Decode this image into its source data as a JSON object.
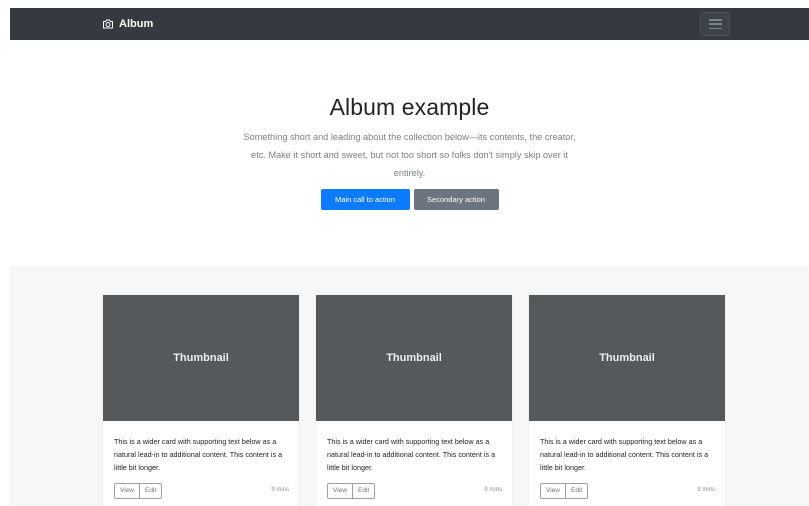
{
  "navbar": {
    "brand": "Album",
    "brand_icon": "camera-icon",
    "toggler_icon": "hamburger-menu-icon",
    "background": "#343a40"
  },
  "hero": {
    "title": "Album example",
    "lead": "Something short and leading about the collection below—its contents, the creator, etc. Make it short and sweet, but not too short so folks don't simply skip over it entirely.",
    "primary_button": "Main call to action",
    "secondary_button": "Secondary action",
    "primary_color": "#0d7bff",
    "secondary_color": "#6c757d"
  },
  "album": {
    "background": "#f6f7f8",
    "cards": [
      {
        "thumbnail": "Thumbnail",
        "text": "This is a wider card with supporting text below as a natural lead-in to additional content. This content is a little bit longer.",
        "view_label": "View",
        "edit_label": "Edit",
        "time": "9 mins"
      },
      {
        "thumbnail": "Thumbnail",
        "text": "This is a wider card with supporting text below as a natural lead-in to additional content. This content is a little bit longer.",
        "view_label": "View",
        "edit_label": "Edit",
        "time": "9 mins"
      },
      {
        "thumbnail": "Thumbnail",
        "text": "This is a wider card with supporting text below as a natural lead-in to additional content. This content is a little bit longer.",
        "view_label": "View",
        "edit_label": "Edit",
        "time": "9 mins"
      }
    ]
  }
}
